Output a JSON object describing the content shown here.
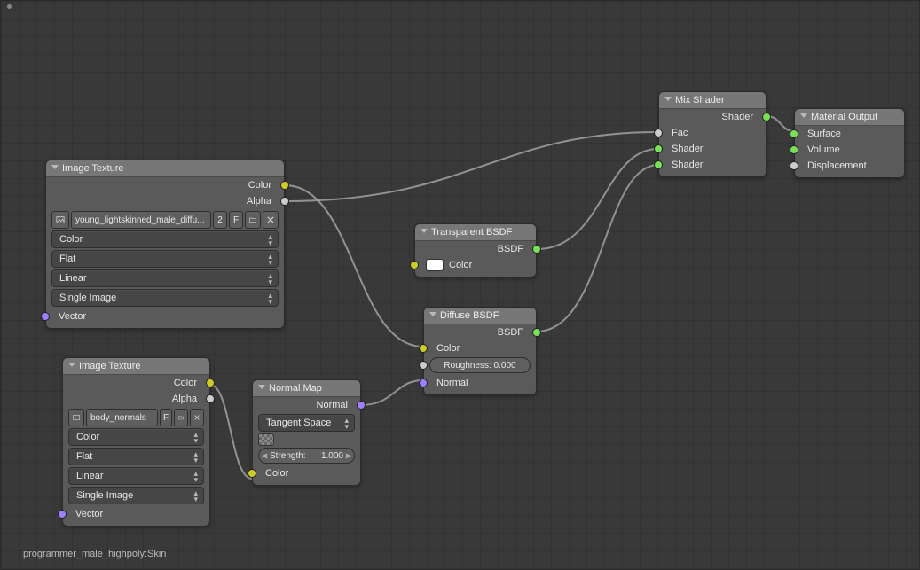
{
  "footer": "programmer_male_highpoly:Skin",
  "nodes": {
    "imgTex1": {
      "title": "Image Texture",
      "out_color": "Color",
      "out_alpha": "Alpha",
      "image_name": "young_lightskinned_male_diffu...",
      "users": "2",
      "fake_user": "F",
      "color_space": "Color",
      "projection": "Flat",
      "interpolation": "Linear",
      "frame_mode": "Single Image",
      "in_vector": "Vector"
    },
    "imgTex2": {
      "title": "Image Texture",
      "out_color": "Color",
      "out_alpha": "Alpha",
      "image_name": "body_normals",
      "fake_user": "F",
      "color_space": "Color",
      "projection": "Flat",
      "interpolation": "Linear",
      "frame_mode": "Single Image",
      "in_vector": "Vector"
    },
    "normalMap": {
      "title": "Normal Map",
      "out_normal": "Normal",
      "space": "Tangent Space",
      "strength_label": "Strength:",
      "strength_value": "1.000",
      "in_color": "Color"
    },
    "transparent": {
      "title": "Transparent BSDF",
      "out_bsdf": "BSDF",
      "in_color": "Color"
    },
    "diffuse": {
      "title": "Diffuse BSDF",
      "out_bsdf": "BSDF",
      "in_color": "Color",
      "roughness_label": "Roughness: 0.000",
      "in_normal": "Normal"
    },
    "mix": {
      "title": "Mix Shader",
      "out_shader": "Shader",
      "in_fac": "Fac",
      "in_shader1": "Shader",
      "in_shader2": "Shader"
    },
    "output": {
      "title": "Material Output",
      "in_surface": "Surface",
      "in_volume": "Volume",
      "in_displacement": "Displacement"
    }
  }
}
